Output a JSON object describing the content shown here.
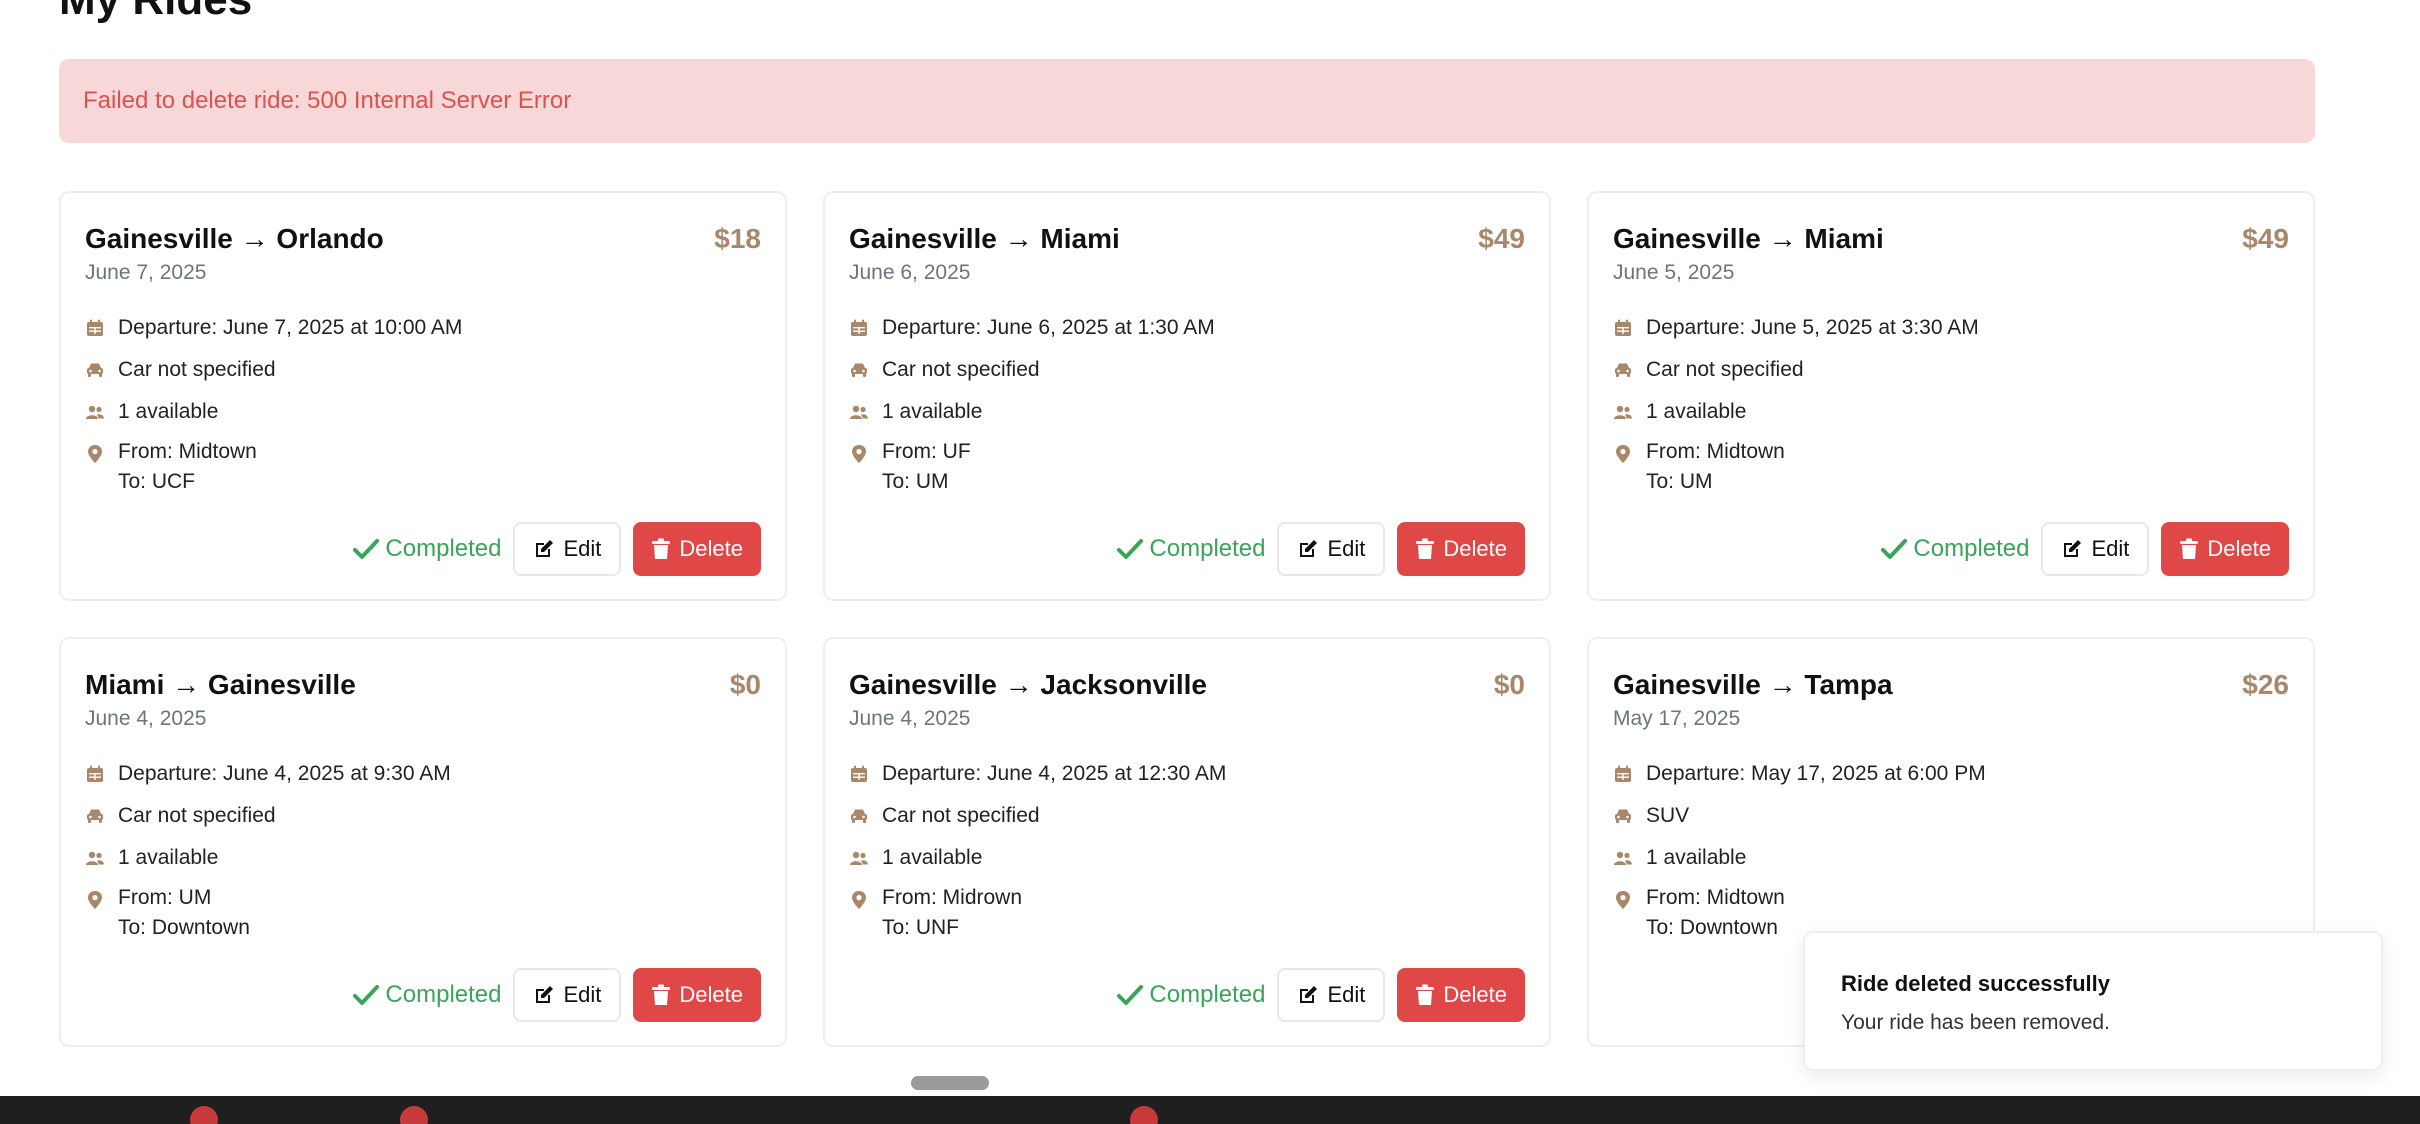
{
  "page": {
    "title": "My Rides"
  },
  "alert": {
    "message": "Failed to delete ride: 500 Internal Server Error"
  },
  "labels": {
    "completed": "Completed",
    "edit": "Edit",
    "delete": "Delete"
  },
  "rides": [
    {
      "route": "Gainesville → Orlando",
      "price": "$18",
      "date": "June 7, 2025",
      "departure": "Departure: June 7, 2025 at 10:00 AM",
      "car": "Car not specified",
      "seats": "1 available",
      "from": "From: Midtown",
      "to": "To: UCF",
      "status": "Completed"
    },
    {
      "route": "Gainesville → Miami",
      "price": "$49",
      "date": "June 6, 2025",
      "departure": "Departure: June 6, 2025 at 1:30 AM",
      "car": "Car not specified",
      "seats": "1 available",
      "from": "From: UF",
      "to": "To: UM",
      "status": "Completed"
    },
    {
      "route": "Gainesville → Miami",
      "price": "$49",
      "date": "June 5, 2025",
      "departure": "Departure: June 5, 2025 at 3:30 AM",
      "car": "Car not specified",
      "seats": "1 available",
      "from": "From: Midtown",
      "to": "To: UM",
      "status": "Completed"
    },
    {
      "route": "Miami → Gainesville",
      "price": "$0",
      "date": "June 4, 2025",
      "departure": "Departure: June 4, 2025 at 9:30 AM",
      "car": "Car not specified",
      "seats": "1 available",
      "from": "From: UM",
      "to": "To: Downtown",
      "status": "Completed"
    },
    {
      "route": "Gainesville → Jacksonville",
      "price": "$0",
      "date": "June 4, 2025",
      "departure": "Departure: June 4, 2025 at 12:30 AM",
      "car": "Car not specified",
      "seats": "1 available",
      "from": "From: Midrown",
      "to": "To: UNF",
      "status": "Completed"
    },
    {
      "route": "Gainesville → Tampa",
      "price": "$26",
      "date": "May 17, 2025",
      "departure": "Departure: May 17, 2025 at 6:00 PM",
      "car": "SUV",
      "seats": "1 available",
      "from": "From: Midtown",
      "to": "To: Downtown",
      "status": ""
    }
  ],
  "toast": {
    "title": "Ride deleted successfully",
    "body": "Your ride has been removed."
  },
  "colors": {
    "accent": "#a8876a",
    "danger": "#e04848",
    "success": "#3aa55a",
    "alert_bg": "#f8d7d9",
    "alert_text": "#d9534f"
  },
  "icons": {
    "departure": "calendar-icon",
    "car": "car-icon",
    "seats": "users-icon",
    "location": "map-pin-icon",
    "status": "check-icon",
    "edit": "edit-icon",
    "delete": "trash-icon"
  }
}
